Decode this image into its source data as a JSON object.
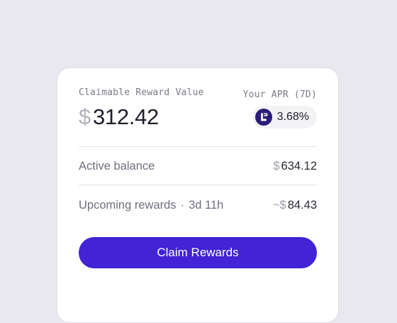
{
  "card": {
    "reward_label": "Claimable Reward Value",
    "reward_currency": "$",
    "reward_value": "312.42",
    "apr_label": "Your APR (7D)",
    "apr_value": "3.68%",
    "apr_icon": "token-logo-icon"
  },
  "rows": [
    {
      "label": "Active balance",
      "sublabel": "",
      "value_prefix": "$",
      "value": "634.12"
    },
    {
      "label": "Upcoming rewards",
      "separator": "·",
      "sublabel": "3d 11h",
      "value_prefix": "~$",
      "value": "84.43"
    }
  ],
  "button": {
    "label": "Claim Rewards"
  },
  "colors": {
    "accent": "#4223d5",
    "token_logo": "#2a1d79",
    "background": "#e8e8ee"
  }
}
